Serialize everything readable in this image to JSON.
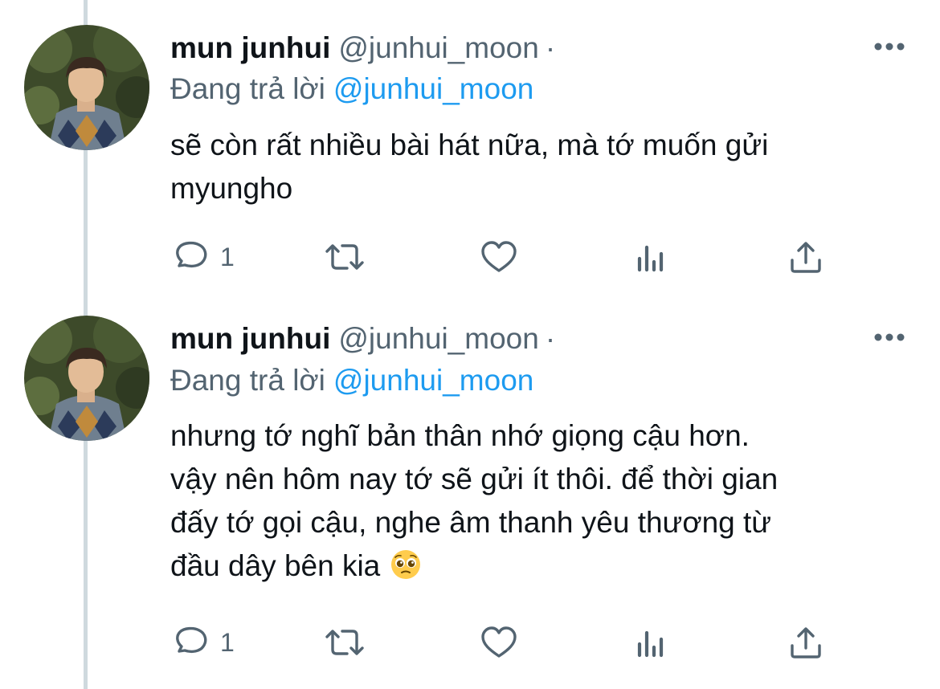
{
  "tweets": [
    {
      "author_name": "mun junhui",
      "handle": "@junhui_moon",
      "separator": "·",
      "replying_prefix": "Đang trả lời",
      "replying_to": "@junhui_moon",
      "body_lines": [
        "sẽ còn rất nhiều bài hát nữa, mà tớ muốn gửi",
        "myungho"
      ],
      "reply_count": "1",
      "emoji": ""
    },
    {
      "author_name": "mun junhui",
      "handle": "@junhui_moon",
      "separator": "·",
      "replying_prefix": "Đang trả lời",
      "replying_to": "@junhui_moon",
      "body_lines": [
        "nhưng tớ nghĩ bản thân nhớ giọng cậu hơn.",
        "vậy nên hôm nay tớ sẽ gửi ít thôi. để thời gian",
        "đấy tớ gọi cậu, nghe âm thanh yêu thương từ",
        "đầu dây bên kia"
      ],
      "reply_count": "1",
      "emoji": "pleading-face-emoji"
    }
  ],
  "icons": {
    "reply": "reply-icon",
    "retweet": "retweet-icon",
    "like": "heart-icon",
    "views": "views-icon",
    "share": "share-icon",
    "more": "more-icon"
  },
  "colors": {
    "text": "#0f1419",
    "secondary": "#536471",
    "link": "#1d9bf0",
    "thread_line": "#cfd9de"
  }
}
